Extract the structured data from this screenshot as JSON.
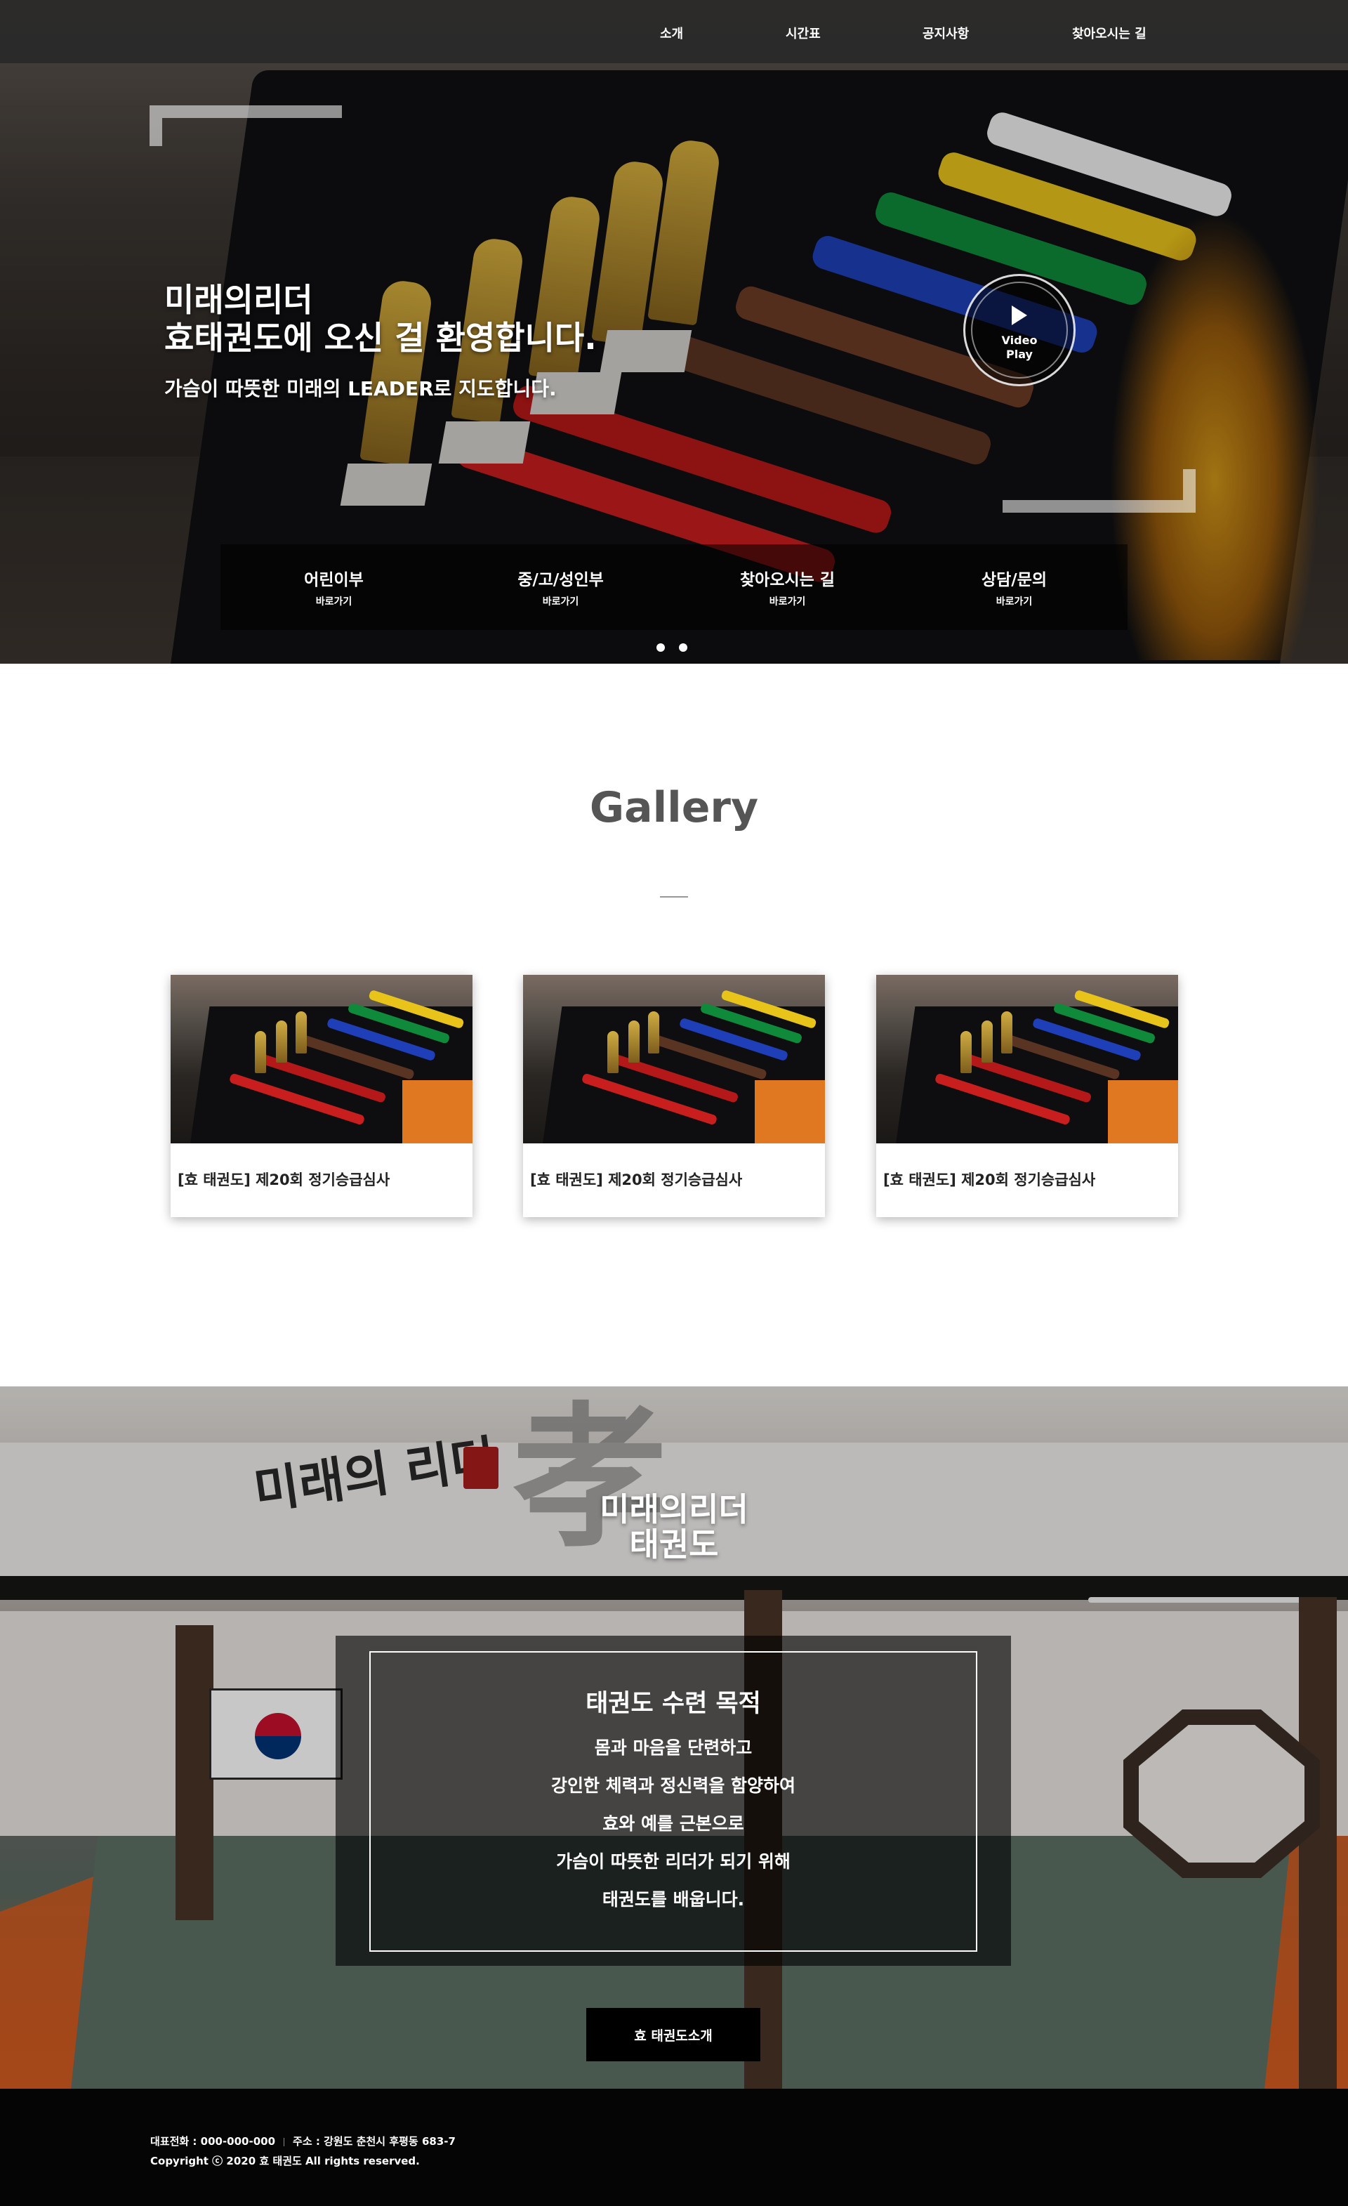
{
  "nav": {
    "items": [
      {
        "label": "소개"
      },
      {
        "label": "시간표"
      },
      {
        "label": "공지사항"
      },
      {
        "label": "찾아오시는 길"
      }
    ]
  },
  "hero": {
    "title_line1": "미래의리더",
    "title_line2": "효태권도에 오신 걸 환영합니다.",
    "subtitle": "가슴이 따뜻한 미래의 LEADER로 지도합니다.",
    "video_label_1": "Video",
    "video_label_2": "Play",
    "quicklinks": [
      {
        "title": "어린이부",
        "sub": "바로가기"
      },
      {
        "title": "중/고/성인부",
        "sub": "바로가기"
      },
      {
        "title": "찾아오시는 길",
        "sub": "바로가기"
      },
      {
        "title": "상담/문의",
        "sub": "바로가기"
      }
    ],
    "slide_count": 2
  },
  "gallery": {
    "title": "Gallery",
    "cards": [
      {
        "caption": "[효 태권도] 제20회 정기승급심사"
      },
      {
        "caption": "[효 태권도] 제20회 정기승급심사"
      },
      {
        "caption": "[효 태권도] 제20회 정기승급심사"
      }
    ]
  },
  "dojo": {
    "hanja": "孝",
    "wall_sign": "미래의 리더",
    "title_line1": "미래의리더",
    "title_line2": "태권도",
    "purpose_title": "태권도 수련 목적",
    "purpose_lines": [
      "몸과 마음을 단련하고",
      "강인한 체력과 정신력을 함양하여",
      "효와 예를 근본으로",
      "가슴이 따뜻한 리더가 되기 위해",
      "태권도를 배웁니다."
    ],
    "button_label": "효 태권도소개"
  },
  "footer": {
    "phone": "대표전화 : 000-000-000",
    "address": "주소 : 강원도 춘천시 후평동 683-7",
    "copyright": "Copyright ⓒ 2020 효 태권도 All rights reserved."
  },
  "colors": {
    "nav_bg": "#282828",
    "footer_bg": "#050505",
    "accent_orange": "#d45c20",
    "button_bg": "#000000"
  },
  "icons": [
    "play-icon"
  ]
}
